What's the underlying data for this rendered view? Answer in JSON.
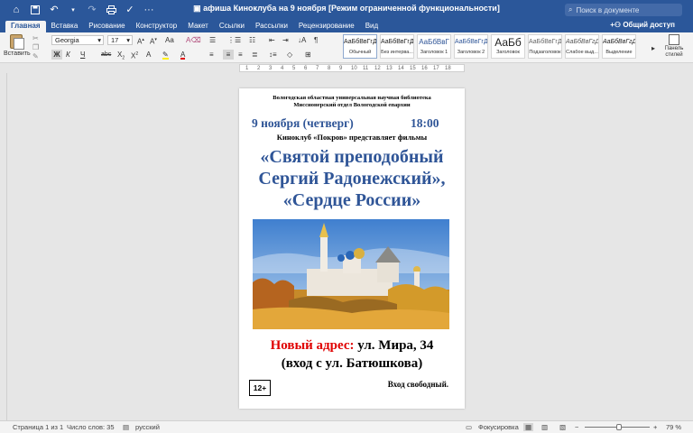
{
  "window": {
    "title": "афиша Киноклуба на 9 ноября [Режим ограниченной функциональности]",
    "search_placeholder": "Поиск в документе"
  },
  "tabs": [
    "Главная",
    "Вставка",
    "Рисование",
    "Конструктор",
    "Макет",
    "Ссылки",
    "Рассылки",
    "Рецензирование",
    "Вид"
  ],
  "share_label": "Общий доступ",
  "ribbon": {
    "paste_label": "Вставить",
    "font_name": "Georgia",
    "font_size": "17",
    "styles": [
      {
        "sample": "АаБбВвГгДд",
        "name": "Обычный"
      },
      {
        "sample": "АаБбВвГгДд",
        "name": "Без интерва..."
      },
      {
        "sample": "АаБбВвГ",
        "name": "Заголовок 1"
      },
      {
        "sample": "АаБбВвГгД",
        "name": "Заголовок 2"
      },
      {
        "sample": "АаБб",
        "name": "Заголовок"
      },
      {
        "sample": "АаБбВвГгДд",
        "name": "Подзаголовок"
      },
      {
        "sample": "АаБбВвГгДd",
        "name": "Слабое выд..."
      },
      {
        "sample": "АаБбВвГгДd",
        "name": "Выделение"
      }
    ],
    "panel_label_1": "Панель",
    "panel_label_2": "стилей"
  },
  "ruler": {
    "marks": [
      "1",
      "2",
      "3",
      "4",
      "5",
      "6",
      "7",
      "8",
      "9",
      "10",
      "11",
      "12",
      "13",
      "14",
      "15",
      "16",
      "17",
      "18"
    ]
  },
  "document": {
    "org_line1": "Вологодская областная универсальная научная библиотека",
    "org_line2": "Миссионерский отдел  Вологодской епархии",
    "date": "9 ноября (четверг)",
    "time": "18:00",
    "club_line": "Киноклуб  «Покров» представляет  фильмы",
    "film_line1": "«Святой преподобный",
    "film_line2": "Сергий Радонежский»,",
    "film_line3": "«Сердце  России»",
    "address_label": "Новый адрес:",
    "address_value": " ул. Мира, 34",
    "entrance": "(вход с ул. Батюшкова)",
    "age_rating": "12+",
    "free_entry": "Вход свободный."
  },
  "statusbar": {
    "page": "Страница 1 из 1",
    "words": "Число слов: 35",
    "language": "русский",
    "focus": "Фокусировка",
    "zoom": "79 %"
  }
}
